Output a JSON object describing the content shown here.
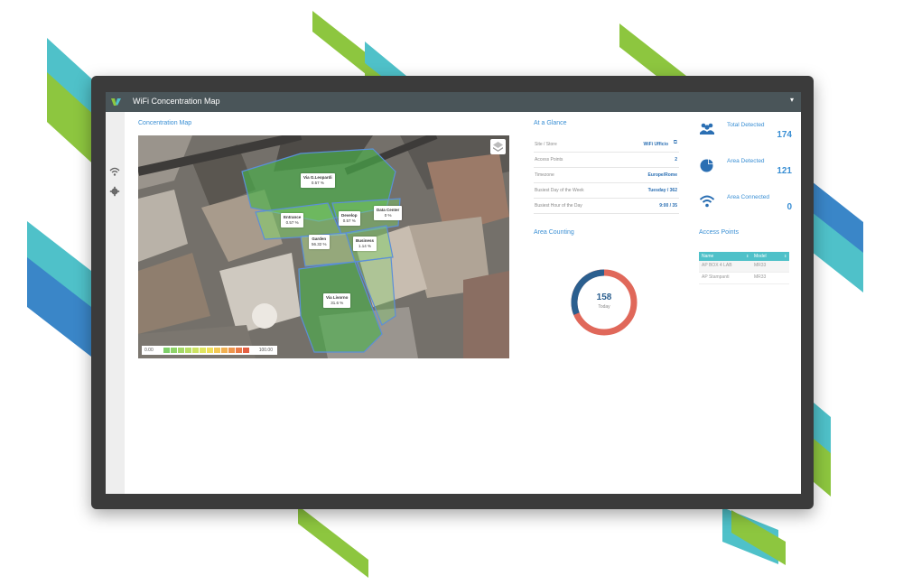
{
  "app": {
    "title": "WiFi Concentration Map"
  },
  "map": {
    "section_title": "Concentration Map",
    "zones": [
      {
        "name": "Via G.Leopardi",
        "percent": "0.57 %"
      },
      {
        "name": "Entrance",
        "percent": "0.57 %"
      },
      {
        "name": "Develop",
        "percent": "0.57 %"
      },
      {
        "name": "Data Center",
        "percent": "0 %"
      },
      {
        "name": "Garden",
        "percent": "56.32 %"
      },
      {
        "name": "Business",
        "percent": "1.14 %"
      },
      {
        "name": "Via Livorno",
        "percent": "31.6 %"
      }
    ],
    "legend": {
      "min": "0.00",
      "max": "100.00"
    }
  },
  "glance": {
    "section_title": "At a Glance",
    "rows": [
      {
        "label": "Site / Store",
        "value": "WiFi Ufficio"
      },
      {
        "label": "Access Points",
        "value": "2"
      },
      {
        "label": "Timezone",
        "value": "Europe/Rome"
      },
      {
        "label": "Busiest Day of the Week",
        "value": "Tuesday / 362"
      },
      {
        "label": "Busiest Hour of the Day",
        "value": "9:00 / 35"
      }
    ]
  },
  "area_counting": {
    "section_title": "Area Counting",
    "value": "158",
    "caption": "Today"
  },
  "stats": {
    "total_detected": {
      "label": "Total Detected",
      "value": "174"
    },
    "area_detected": {
      "label": "Area Detected",
      "value": "121"
    },
    "area_connected": {
      "label": "Area Connected",
      "value": "0"
    }
  },
  "access_points": {
    "section_title": "Access Points",
    "columns": [
      "Name",
      "Model"
    ],
    "rows": [
      {
        "name": "AP BOX 4 LAB",
        "model": "MR33"
      },
      {
        "name": "AP Stampanti",
        "model": "MR33"
      }
    ]
  },
  "colors": {
    "accent": "#3a8fd4",
    "topbar": "#4a5559",
    "teal": "#4fc1c9",
    "green": "#8dc63f",
    "donut_blue": "#2b5f8f",
    "donut_red": "#e0685a"
  }
}
